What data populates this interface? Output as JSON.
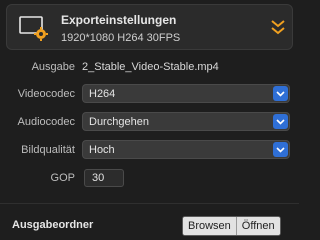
{
  "export": {
    "title": "Exporteinstellungen",
    "summary": "1920*1080 H264 30FPS",
    "icon": "monitor-gear-icon",
    "collapse_icon": "double-chevron-down-icon",
    "accent_color": "#f0a020"
  },
  "settings": {
    "output_label": "Ausgabe",
    "output_value": "2_Stable_Video-Stable.mp4",
    "videocodec_label": "Videocodec",
    "videocodec_value": "H264",
    "audiocodec_label": "Audiocodec",
    "audiocodec_value": "Durchgehen",
    "quality_label": "Bildqualität",
    "quality_value": "Hoch",
    "gop_label": "GOP",
    "gop_value": "30"
  },
  "output_folder": {
    "title": "Ausgabeordner",
    "browse_label": "Browsen",
    "open_label": "Öffnen"
  },
  "colors": {
    "select_arrow_bg": "#2f6fd6",
    "background": "#1e1e1e"
  }
}
